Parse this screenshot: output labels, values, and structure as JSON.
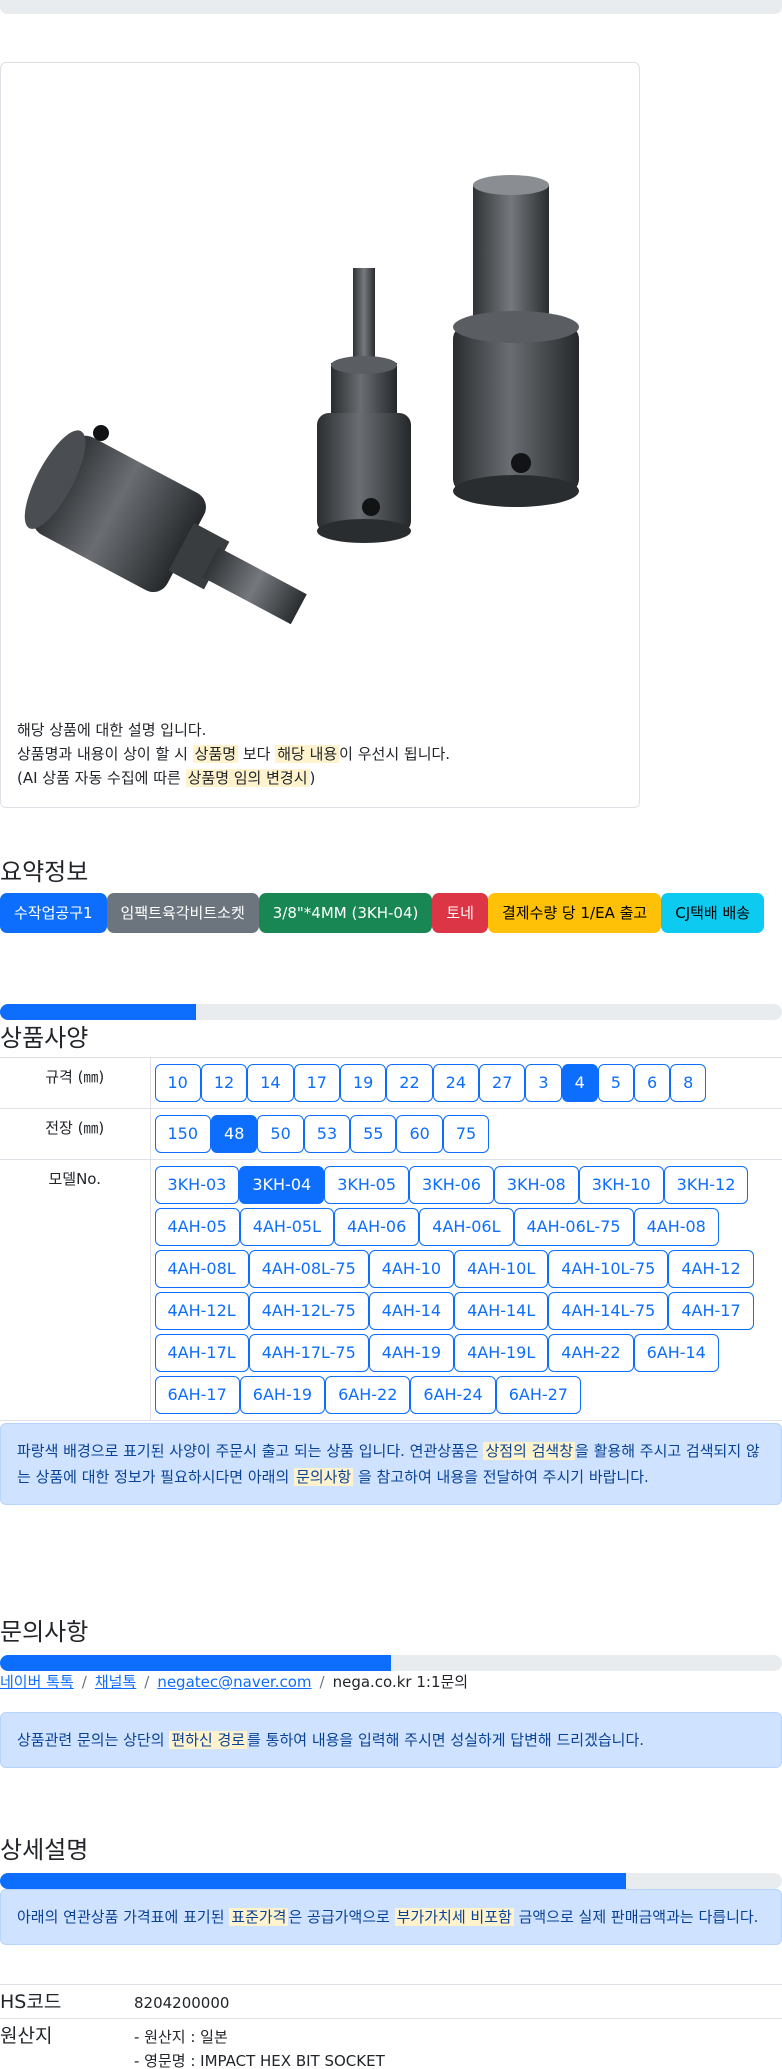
{
  "product": {
    "image_alt": "hex bit sockets photo",
    "description_line1": "해당 상품에 대한 설명 입니다.",
    "description_line2_a": "상품명과 내용이 상이 할 시 ",
    "description_line2_hl1": "상품명",
    "description_line2_b": " 보다 ",
    "description_line2_hl2": "해당 내용",
    "description_line2_c": "이 우선시 됩니다.",
    "description_line3_a": "(AI 상품 자동 수집에 따른 ",
    "description_line3_hl": "상품명 임의 변경시",
    "description_line3_b": ")"
  },
  "summary": {
    "title": "요약정보",
    "badges": [
      {
        "label": "수작업공구1",
        "color": "#0d6efd",
        "text_color": "#ffffff"
      },
      {
        "label": "임팩트육각비트소켓",
        "color": "#6c757d",
        "text_color": "#ffffff"
      },
      {
        "label": "3/8\"*4MM (3KH-04)",
        "color": "#198754",
        "text_color": "#ffffff"
      },
      {
        "label": "토네",
        "color": "#dc3545",
        "text_color": "#ffffff"
      },
      {
        "label": "결제수량 당 1/EA 출고",
        "color": "#ffc107",
        "text_color": "#000000"
      },
      {
        "label": "CJ택배 배송",
        "color": "#0dcaf0",
        "text_color": "#000000"
      }
    ]
  },
  "spec": {
    "progress": 0.25,
    "title": "상품사양",
    "rows": [
      {
        "label": "규격 (㎜)",
        "options": [
          "10",
          "12",
          "14",
          "17",
          "19",
          "22",
          "24",
          "27",
          "3",
          "4",
          "5",
          "6",
          "8"
        ],
        "selected": "4"
      },
      {
        "label": "전장 (㎜)",
        "options": [
          "150",
          "48",
          "50",
          "53",
          "55",
          "60",
          "75"
        ],
        "selected": "48"
      },
      {
        "label": "모델No.",
        "options": [
          "3KH-03",
          "3KH-04",
          "3KH-05",
          "3KH-06",
          "3KH-08",
          "3KH-10",
          "3KH-12",
          "4AH-05",
          "4AH-05L",
          "4AH-06",
          "4AH-06L",
          "4AH-06L-75",
          "4AH-08",
          "4AH-08L",
          "4AH-08L-75",
          "4AH-10",
          "4AH-10L",
          "4AH-10L-75",
          "4AH-12",
          "4AH-12L",
          "4AH-12L-75",
          "4AH-14",
          "4AH-14L",
          "4AH-14L-75",
          "4AH-17",
          "4AH-17L",
          "4AH-17L-75",
          "4AH-19",
          "4AH-19L",
          "4AH-22",
          "6AH-14",
          "6AH-17",
          "6AH-19",
          "6AH-22",
          "6AH-24",
          "6AH-27"
        ],
        "selected": "3KH-04"
      }
    ],
    "notice_a": "파랑색 배경으로 표기된 사양이 주문시 출고 되는 상품 입니다. 연관상품은 ",
    "notice_hl1": "상점의 검색창",
    "notice_b": "을 활용해 주시고 검색되지 않는 상품에 대한 정보가 필요하시다면 아래의 ",
    "notice_hl2": "문의사항",
    "notice_c": " 을 참고하여 내용을 전달하여 주시기 바랍니다."
  },
  "inquiry": {
    "title": "문의사항",
    "progress": 0.5,
    "links": [
      "네이버 톡톡",
      "채널톡",
      "negatec@naver.com"
    ],
    "plain": "nega.co.kr 1:1문의",
    "separator": "/",
    "notice_a": "상품관련 문의는 상단의 ",
    "notice_hl": "편하신 경로",
    "notice_b": "를 통하여 내용을 입력해 주시면 성실하게 답변해 드리겠습니다."
  },
  "detail": {
    "title": "상세설명",
    "progress": 0.8,
    "notice_a": "아래의 연관상품 가격표에 표기된 ",
    "notice_hl1": "표준가격",
    "notice_b": "은 공급가액으로 ",
    "notice_hl2": "부가가치세 비포함",
    "notice_c": " 금액으로 실제 판매금액과는 다릅니다.",
    "hs_label": "HS코드",
    "hs_value": "8204200000",
    "origin_label": "원산지",
    "origin_line1": "- 원산지 : 일본",
    "origin_line2": "- 영문명 : IMPACT HEX BIT SOCKET"
  }
}
